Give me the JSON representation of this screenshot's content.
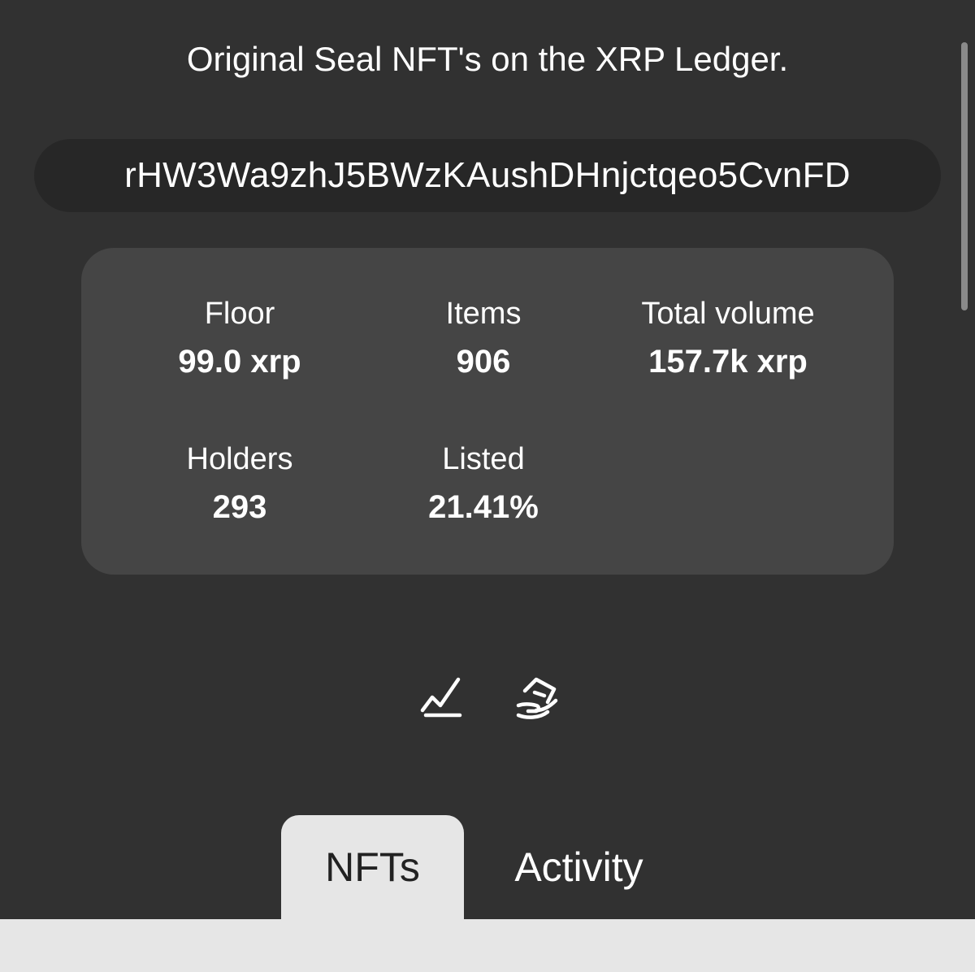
{
  "collection": {
    "description": "Original Seal NFT's on the XRP Ledger.",
    "address": "rHW3Wa9zhJ5BWzKAushDHnjctqeo5CvnFD"
  },
  "stats": {
    "floor": {
      "label": "Floor",
      "value": "99.0 xrp"
    },
    "items": {
      "label": "Items",
      "value": "906"
    },
    "total_volume": {
      "label": "Total volume",
      "value": "157.7k xrp"
    },
    "holders": {
      "label": "Holders",
      "value": "293"
    },
    "listed": {
      "label": "Listed",
      "value": "21.41%"
    }
  },
  "actions": {
    "icons": [
      "chart-line-icon",
      "hand-offer-icon"
    ]
  },
  "tabs": [
    {
      "label": "NFTs",
      "active": true
    },
    {
      "label": "Activity",
      "active": false
    }
  ],
  "colors": {
    "background": "#313131",
    "card": "#454545",
    "address_pill": "#272727",
    "active_tab": "#e6e6e6",
    "text": "#ffffff"
  }
}
